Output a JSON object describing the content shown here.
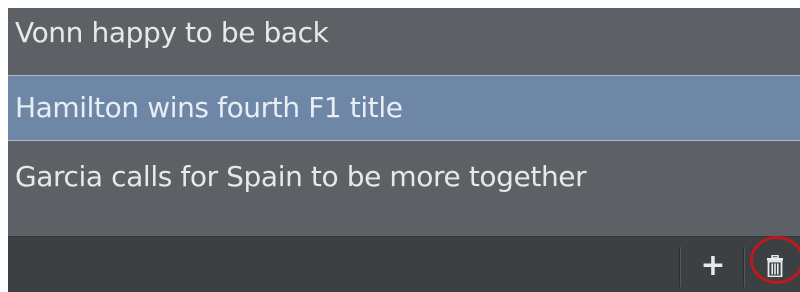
{
  "list": {
    "items": [
      {
        "label": "Vonn happy to be back",
        "selected": false
      },
      {
        "label": "Hamilton wins fourth F1 title",
        "selected": true
      },
      {
        "label": "Garcia calls for Spain to be more together",
        "selected": false
      }
    ]
  },
  "toolbar": {
    "add_label": "+",
    "add_icon": "plus-icon",
    "delete_icon": "trash-icon"
  },
  "colors": {
    "panel_bg": "#5d6165",
    "selected_bg": "#6e87a6",
    "toolbar_bg": "#3c4043",
    "highlight_ring": "#c0181c"
  }
}
